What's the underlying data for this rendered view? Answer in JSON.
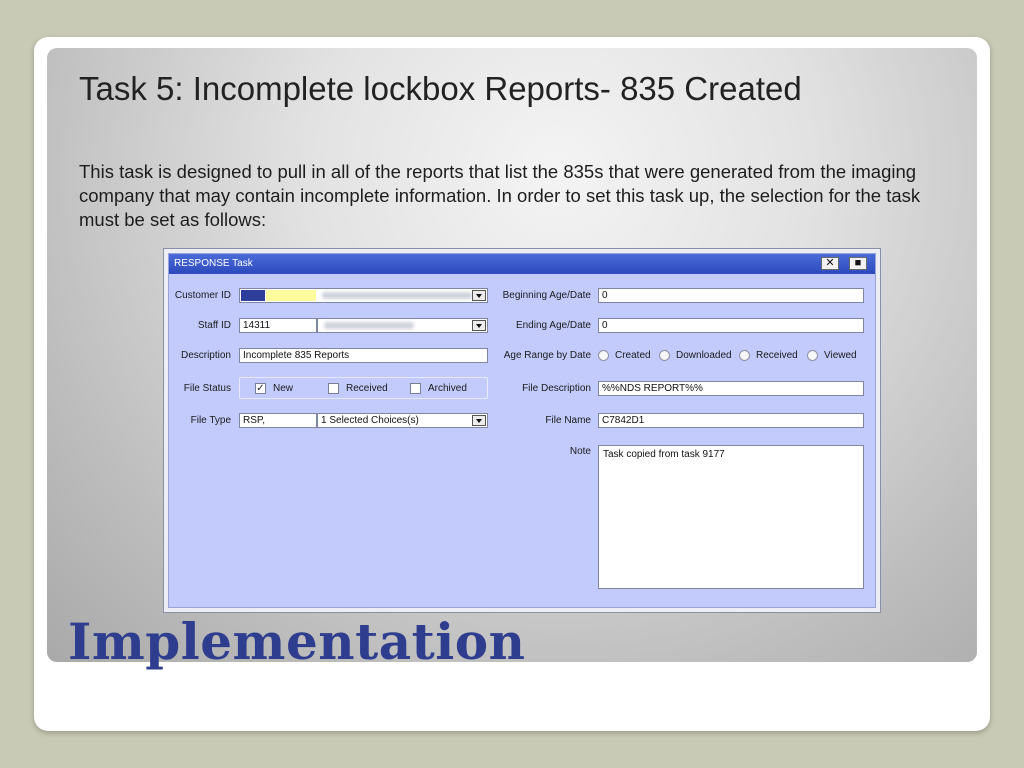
{
  "slide": {
    "title": "Task 5: Incomplete lockbox Reports- 835 Created",
    "body": "This task is designed to pull in all of the reports that list the 835s that were generated from the imaging company that may contain incomplete information. In order to set this task up, the selection for the task must be set as follows:",
    "footer_title": "Implementation"
  },
  "window": {
    "title": "RESPONSE Task",
    "close_icon": "close-icon",
    "save_icon": "save-icon"
  },
  "form": {
    "customer_id": {
      "label": "Customer ID",
      "value": ""
    },
    "staff_id": {
      "label": "Staff ID",
      "value": "14311"
    },
    "description": {
      "label": "Description",
      "value": "Incomplete 835 Reports"
    },
    "file_status": {
      "label": "File Status",
      "options": [
        {
          "label": "New",
          "checked": true
        },
        {
          "label": "Received",
          "checked": false
        },
        {
          "label": "Archived",
          "checked": false
        }
      ]
    },
    "file_type": {
      "label": "File Type",
      "value": "RSP,",
      "choices": "1 Selected Choices(s)"
    },
    "beginning_age": {
      "label": "Beginning Age/Date",
      "value": "0"
    },
    "ending_age": {
      "label": "Ending Age/Date",
      "value": "0"
    },
    "age_range": {
      "label": "Age Range by Date",
      "options": [
        "Created",
        "Downloaded",
        "Received",
        "Viewed"
      ]
    },
    "file_description": {
      "label": "File Description",
      "value": "%%NDS REPORT%%"
    },
    "file_name": {
      "label": "File Name",
      "value": "C7842D1"
    },
    "note": {
      "label": "Note",
      "value": "Task copied from task 9177"
    }
  },
  "colors": {
    "accent": "#2f3d8f",
    "form_bg": "#c2cbfc",
    "titlebar": "#3557c8"
  }
}
